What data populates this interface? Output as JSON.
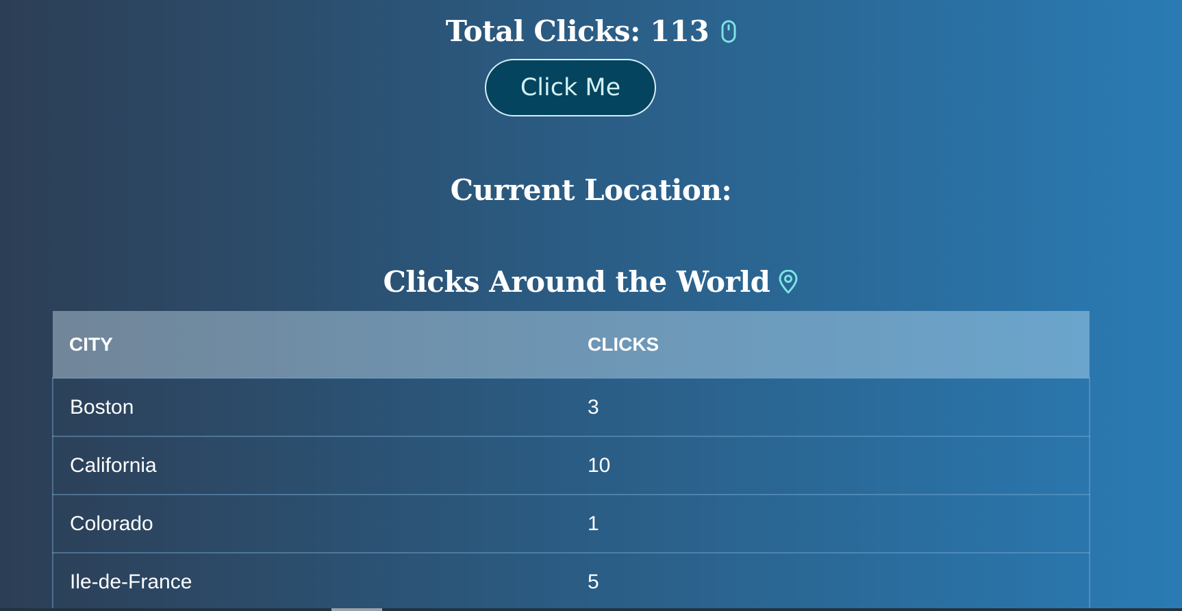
{
  "header": {
    "total_clicks_label": "Total Clicks: 113",
    "total_clicks_icon": "mouse-icon"
  },
  "click_button": {
    "label": "Click Me"
  },
  "location": {
    "title": "Current Location:"
  },
  "world": {
    "title": "Clicks Around the World",
    "icon": "map-pin-icon"
  },
  "table": {
    "headers": [
      "CITY",
      "CLICKS"
    ],
    "rows": [
      {
        "city": "Boston",
        "clicks": "3"
      },
      {
        "city": "California",
        "clicks": "10"
      },
      {
        "city": "Colorado",
        "clicks": "1"
      },
      {
        "city": "Ile-de-France",
        "clicks": "5"
      }
    ]
  },
  "colors": {
    "accent": "#7de3e1",
    "button_bg": "#05445e",
    "button_text": "#d4f1f4"
  }
}
